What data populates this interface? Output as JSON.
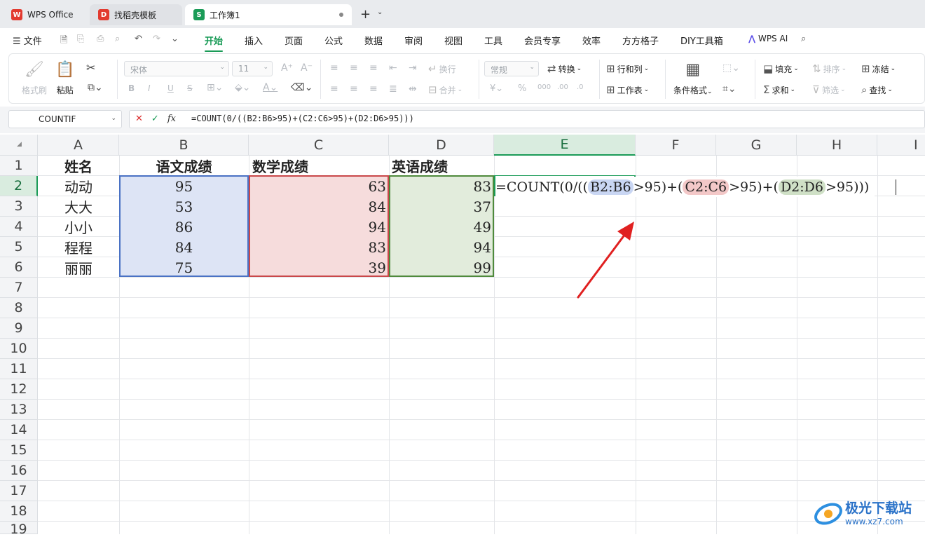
{
  "tabs": [
    {
      "label": "WPS Office",
      "icon": "wps-logo-icon",
      "color": "#e23a2f"
    },
    {
      "label": "找稻壳模板",
      "icon": "docer-icon",
      "color": "#e23a2f"
    },
    {
      "label": "工作簿1",
      "icon": "sheet-icon",
      "color": "#1a9b57",
      "glyph": "S"
    }
  ],
  "menu": {
    "file": "文件",
    "items": [
      "开始",
      "插入",
      "页面",
      "公式",
      "数据",
      "审阅",
      "视图",
      "工具",
      "会员专享",
      "效率",
      "方方格子",
      "DIY工具箱"
    ],
    "active": "开始",
    "ai": "WPS AI"
  },
  "ribbon": {
    "format_painter": "格式刷",
    "paste": "粘贴",
    "font_name": "宋体",
    "font_size": "11",
    "bold": "B",
    "italic": "I",
    "underline": "U",
    "strike": "S",
    "wrap": "换行",
    "merge": "合并",
    "number_format": "常规",
    "convert": "转换",
    "rowcol": "行和列",
    "worksheet": "工作表",
    "cond_format": "条件格式",
    "fill": "填充",
    "sort": "排序",
    "freeze": "冻结",
    "sum": "求和",
    "filter": "筛选",
    "find": "查找"
  },
  "formula_bar": {
    "name_box": "COUNTIF",
    "formula": "=COUNT(0/((B2:B6>95)+(C2:C6>95)+(D2:D6>95)))"
  },
  "columns": [
    "A",
    "B",
    "C",
    "D",
    "E",
    "F",
    "G",
    "H",
    "I"
  ],
  "rows": [
    "1",
    "2",
    "3",
    "4",
    "5",
    "6",
    "7",
    "8",
    "9",
    "10",
    "11",
    "12",
    "13",
    "14",
    "15",
    "16",
    "17",
    "18",
    "19"
  ],
  "headers": [
    "姓名",
    "语文成绩",
    "数学成绩",
    "英语成绩"
  ],
  "table": [
    [
      "动动",
      "95",
      "63",
      "83"
    ],
    [
      "大大",
      "53",
      "84",
      "37"
    ],
    [
      "小小",
      "86",
      "94",
      "49"
    ],
    [
      "程程",
      "84",
      "83",
      "94"
    ],
    [
      "丽丽",
      "75",
      "39",
      "99"
    ]
  ],
  "edit": {
    "p1": "=COUNT(0/((",
    "r1": "B2:B6",
    "p2": ">95)+(",
    "r2": "C2:C6",
    "p3": ">95)+(",
    "r3": "D2:D6",
    "p4": ">95)))"
  },
  "colors": {
    "accent": "#1a9b57",
    "range_b": "#dde4f5",
    "range_c": "#f6dcdc",
    "range_d": "#e2ecdc"
  },
  "watermark": {
    "title": "极光下载站",
    "url": "www.xz7.com"
  }
}
